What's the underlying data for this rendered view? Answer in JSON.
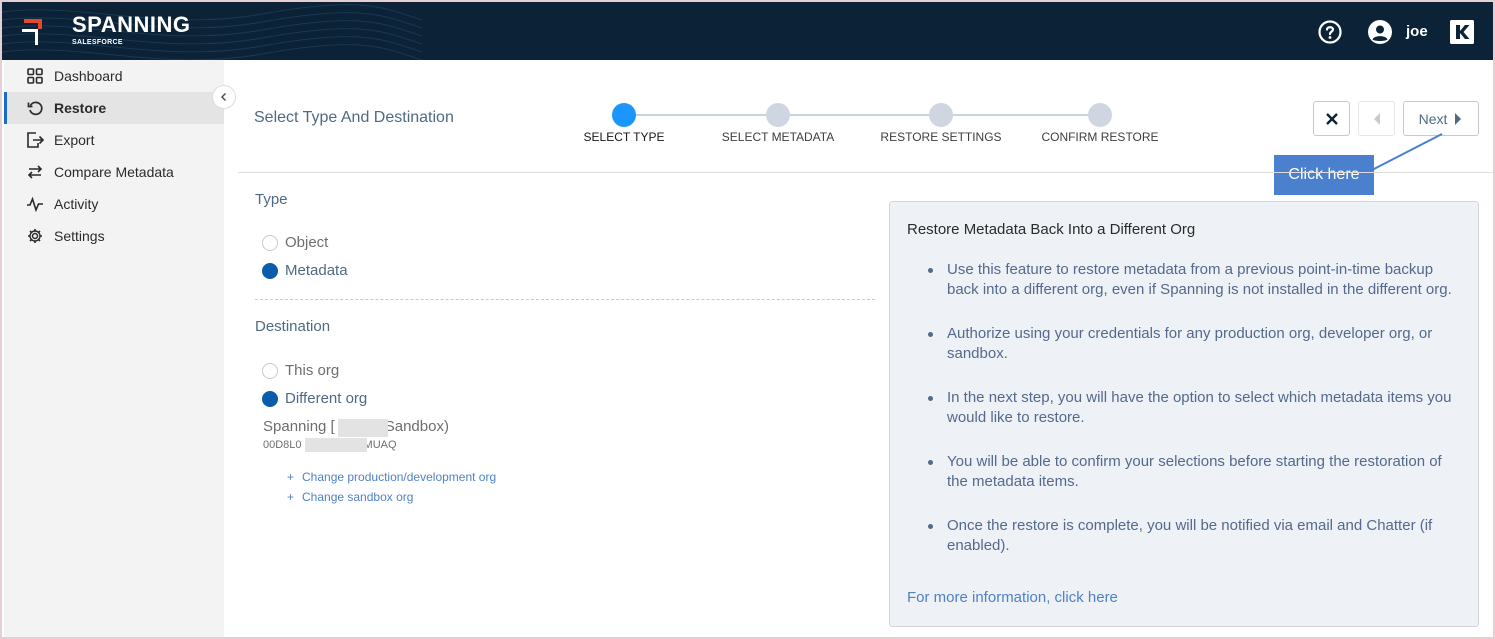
{
  "brand": {
    "name": "SPANNING",
    "sub": "SALESFORCE"
  },
  "header": {
    "user": "joe"
  },
  "sidebar": {
    "items": [
      {
        "label": "Dashboard",
        "icon": "grid-icon"
      },
      {
        "label": "Restore",
        "icon": "restore-icon",
        "active": true
      },
      {
        "label": "Export",
        "icon": "export-icon"
      },
      {
        "label": "Compare Metadata",
        "icon": "compare-icon"
      },
      {
        "label": "Activity",
        "icon": "activity-icon"
      },
      {
        "label": "Settings",
        "icon": "gear-icon"
      }
    ]
  },
  "main": {
    "title": "Select Type And Destination",
    "steps": [
      {
        "label": "SELECT TYPE",
        "active": true
      },
      {
        "label": "SELECT METADATA"
      },
      {
        "label": "RESTORE SETTINGS"
      },
      {
        "label": "CONFIRM RESTORE"
      }
    ],
    "next_label": "Next",
    "callout": "Click here"
  },
  "form": {
    "type_heading": "Type",
    "type_options": [
      {
        "label": "Object",
        "checked": false
      },
      {
        "label": "Metadata",
        "checked": true
      }
    ],
    "destination_heading": "Destination",
    "destination_options": [
      {
        "label": "This org",
        "checked": false
      },
      {
        "label": "Different org",
        "checked": true
      }
    ],
    "org_name_start": "Spanning [",
    "org_name_end": "Sandbox)",
    "org_id_start": "00D8L0",
    "org_id_end": "MUAQ",
    "links": [
      "Change production/development org",
      "Change sandbox org"
    ]
  },
  "info": {
    "title": "Restore Metadata Back Into a Different Org",
    "bullets": [
      "Use this feature to restore metadata from a previous point-in-time backup back into a different org, even if Spanning is not installed in the different org.",
      "Authorize using your credentials for any production org, developer org, or sandbox.",
      "In the next step, you will have the option to select which metadata items you would like to restore.",
      "You will be able to confirm your selections before starting the restoration of the metadata items.",
      "Once the restore is complete, you will be notified via email and Chatter (if enabled)."
    ],
    "link": "For more information, click here"
  },
  "colors": {
    "header_bg": "#0c2236",
    "accent": "#1b96ff",
    "radio_checked": "#0b5cab",
    "callout": "#4a80cd"
  }
}
